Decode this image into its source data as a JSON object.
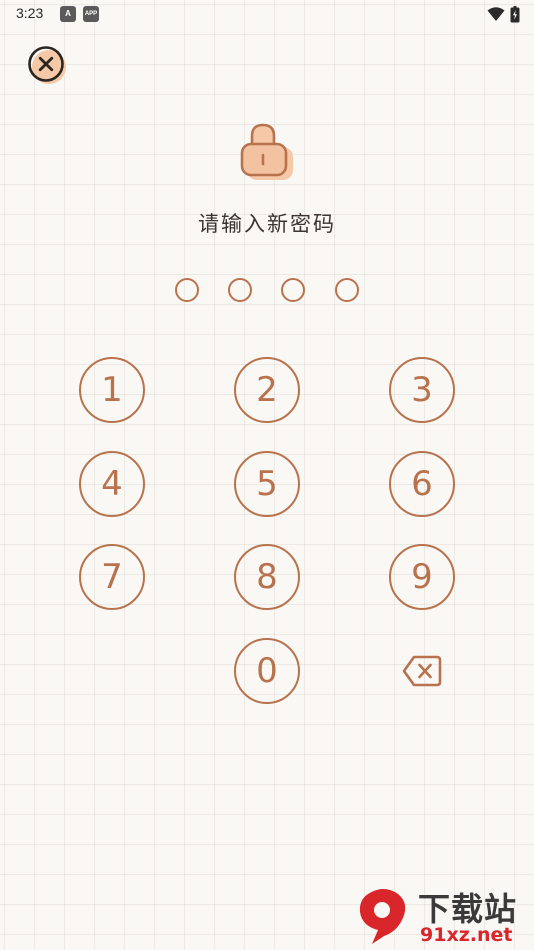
{
  "status_bar": {
    "time": "3:23",
    "notification_icons": [
      "a-notification-icon",
      "app-notification-icon"
    ],
    "notification_glyphs": [
      "A",
      "APP"
    ],
    "right_icons": [
      "wifi-icon",
      "battery-icon"
    ]
  },
  "header": {
    "close_icon": "close-icon"
  },
  "lock": {
    "icon": "lock-icon"
  },
  "prompt": {
    "text": "请输入新密码"
  },
  "pin": {
    "length": 4,
    "filled": 0
  },
  "keypad": {
    "keys": [
      "1",
      "2",
      "3",
      "4",
      "5",
      "6",
      "7",
      "8",
      "9",
      "0"
    ],
    "backspace_icon": "backspace-icon"
  },
  "watermark": {
    "logo_text": "9",
    "title": "下载站",
    "domain": "91xz.net"
  },
  "colors": {
    "accent": "#b8734e",
    "accent_light": "#f5c9a8",
    "background": "#faf8f4",
    "text": "#3a3530",
    "watermark_red": "#d9262b"
  }
}
